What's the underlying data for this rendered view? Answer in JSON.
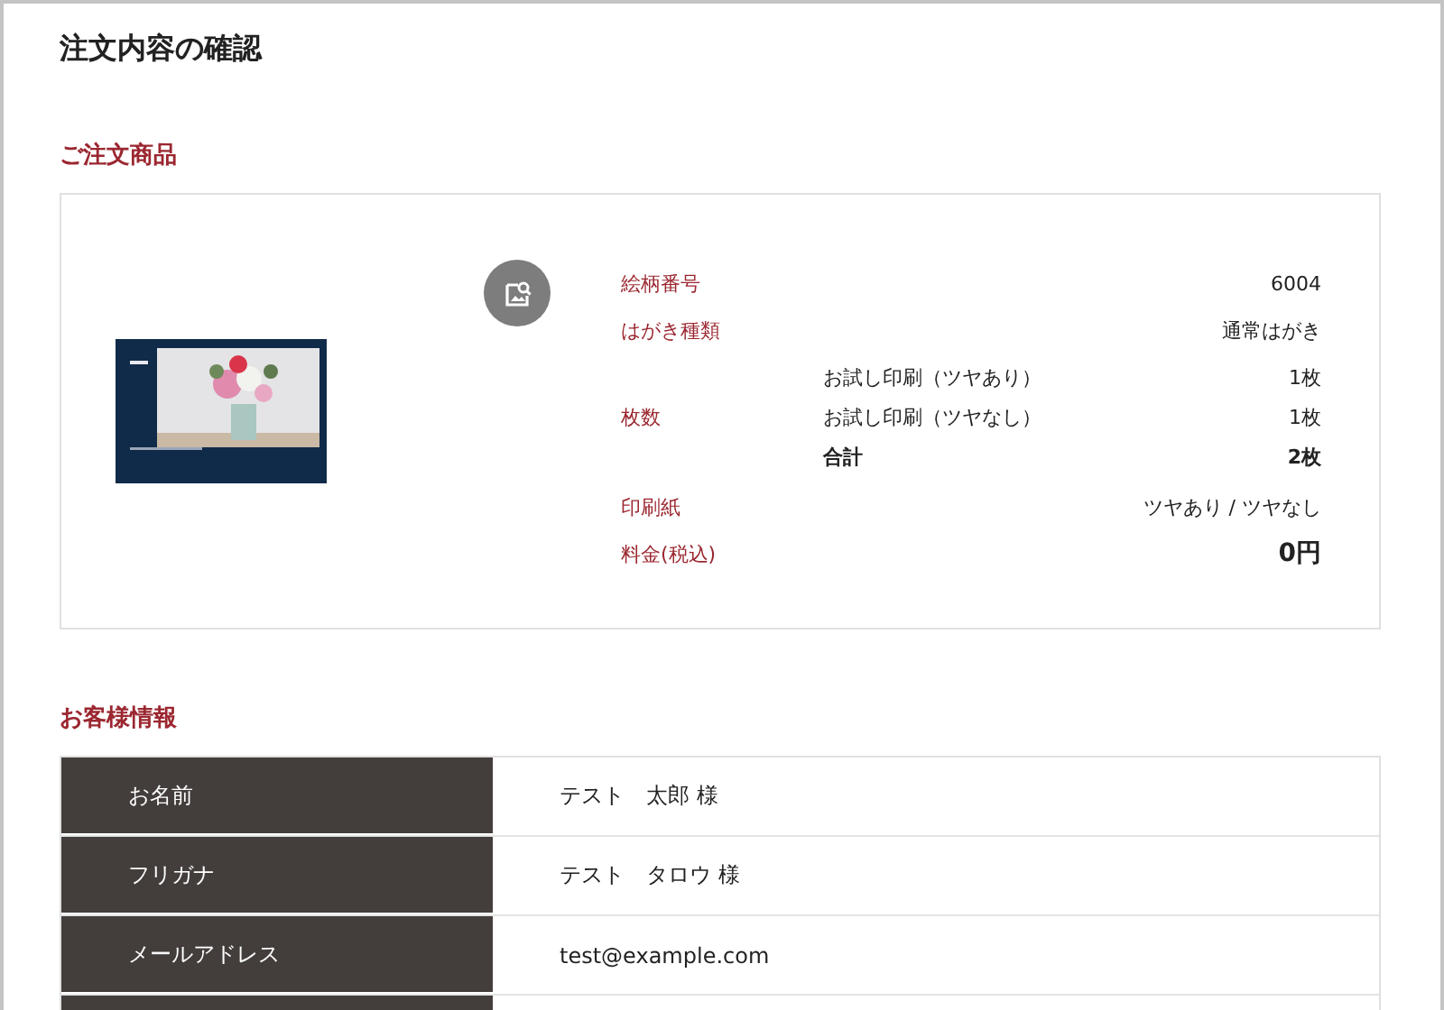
{
  "page_title": "注文内容の確認",
  "product_section": {
    "heading": "ご注文商品",
    "details": [
      {
        "kind": "row",
        "label": "絵柄番号",
        "value": "6004",
        "emphasis": false
      },
      {
        "kind": "row",
        "label": "はがき種類",
        "value": "通常はがき",
        "emphasis": false
      },
      {
        "kind": "breakdown",
        "label": "枚数",
        "lines": [
          {
            "kind": "item",
            "name": "お試し印刷（ツヤあり）",
            "value": "1枚"
          },
          {
            "kind": "item",
            "name": "お試し印刷（ツヤなし）",
            "value": "1枚"
          },
          {
            "kind": "total",
            "name": "合計",
            "value": "2枚"
          }
        ]
      },
      {
        "kind": "row",
        "label": "印刷紙",
        "value": "ツヤあり / ツヤなし",
        "emphasis": false
      },
      {
        "kind": "row",
        "label": "料金(税込)",
        "value": "0円",
        "emphasis": true
      }
    ]
  },
  "customer_section": {
    "heading": "お客様情報",
    "rows": [
      {
        "label": "お名前",
        "value": "テスト　太郎 様"
      },
      {
        "label": "フリガナ",
        "value": "テスト　タロウ 様"
      },
      {
        "label": "メールアドレス",
        "value": "test@example.com"
      }
    ]
  }
}
